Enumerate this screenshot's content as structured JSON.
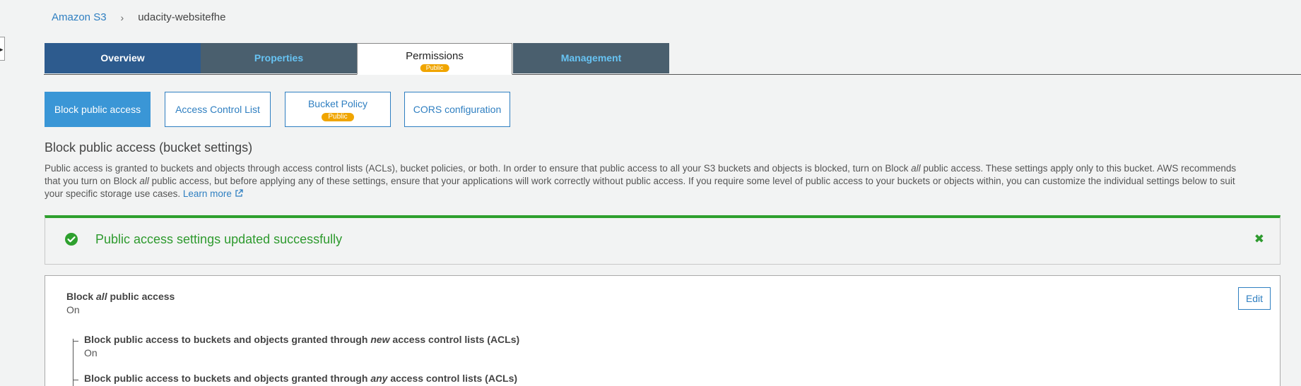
{
  "breadcrumb": {
    "root": "Amazon S3",
    "separator": "›",
    "current": "udacity-websitefhe"
  },
  "tabs": {
    "overview": "Overview",
    "properties": "Properties",
    "permissions": "Permissions",
    "permissions_badge": "Public",
    "management": "Management"
  },
  "subtabs": {
    "block_public_access": "Block public access",
    "acl": "Access Control List",
    "bucket_policy": "Bucket Policy",
    "bucket_policy_badge": "Public",
    "cors": "CORS configuration"
  },
  "section": {
    "title": "Block public access (bucket settings)",
    "intro_1": "Public access is granted to buckets and objects through access control lists (ACLs), bucket policies, or both. In order to ensure that public access to all your S3 buckets and objects is blocked, turn on Block ",
    "intro_em1": "all",
    "intro_2": " public access. These settings apply only to this bucket. AWS recommends that you turn on Block ",
    "intro_em2": "all",
    "intro_3": " public access, but before applying any of these settings, ensure that your applications will work correctly without public access. If you require some level of public access to your buckets or objects within, you can customize the individual settings below to suit your specific storage use cases. ",
    "learn_more": "Learn more"
  },
  "alert": {
    "message": "Public access settings updated successfully",
    "close_glyph": "✖"
  },
  "settings": {
    "block_all_pre": "Block ",
    "block_all_em": "all",
    "block_all_post": " public access",
    "block_all_value": "On",
    "edit_label": "Edit",
    "items": [
      {
        "pre": "Block public access to buckets and objects granted through ",
        "em": "new",
        "post": " access control lists (ACLs)",
        "value": "On"
      },
      {
        "pre": "Block public access to buckets and objects granted through ",
        "em": "any",
        "post": " access control lists (ACLs)",
        "value": ""
      }
    ]
  },
  "colors": {
    "tab_active_blue": "#2d5b8e",
    "tab_inactive": "#4a5f6e",
    "tab_inactive_text": "#67c3f3",
    "link_blue": "#2f7fc1",
    "badge_orange": "#f0a500",
    "success_green": "#2ea02e"
  },
  "icons": {
    "sidebar_toggle": "chevron-right-icon",
    "external_link": "external-link-icon",
    "success": "check-circle-icon",
    "close": "close-icon"
  }
}
